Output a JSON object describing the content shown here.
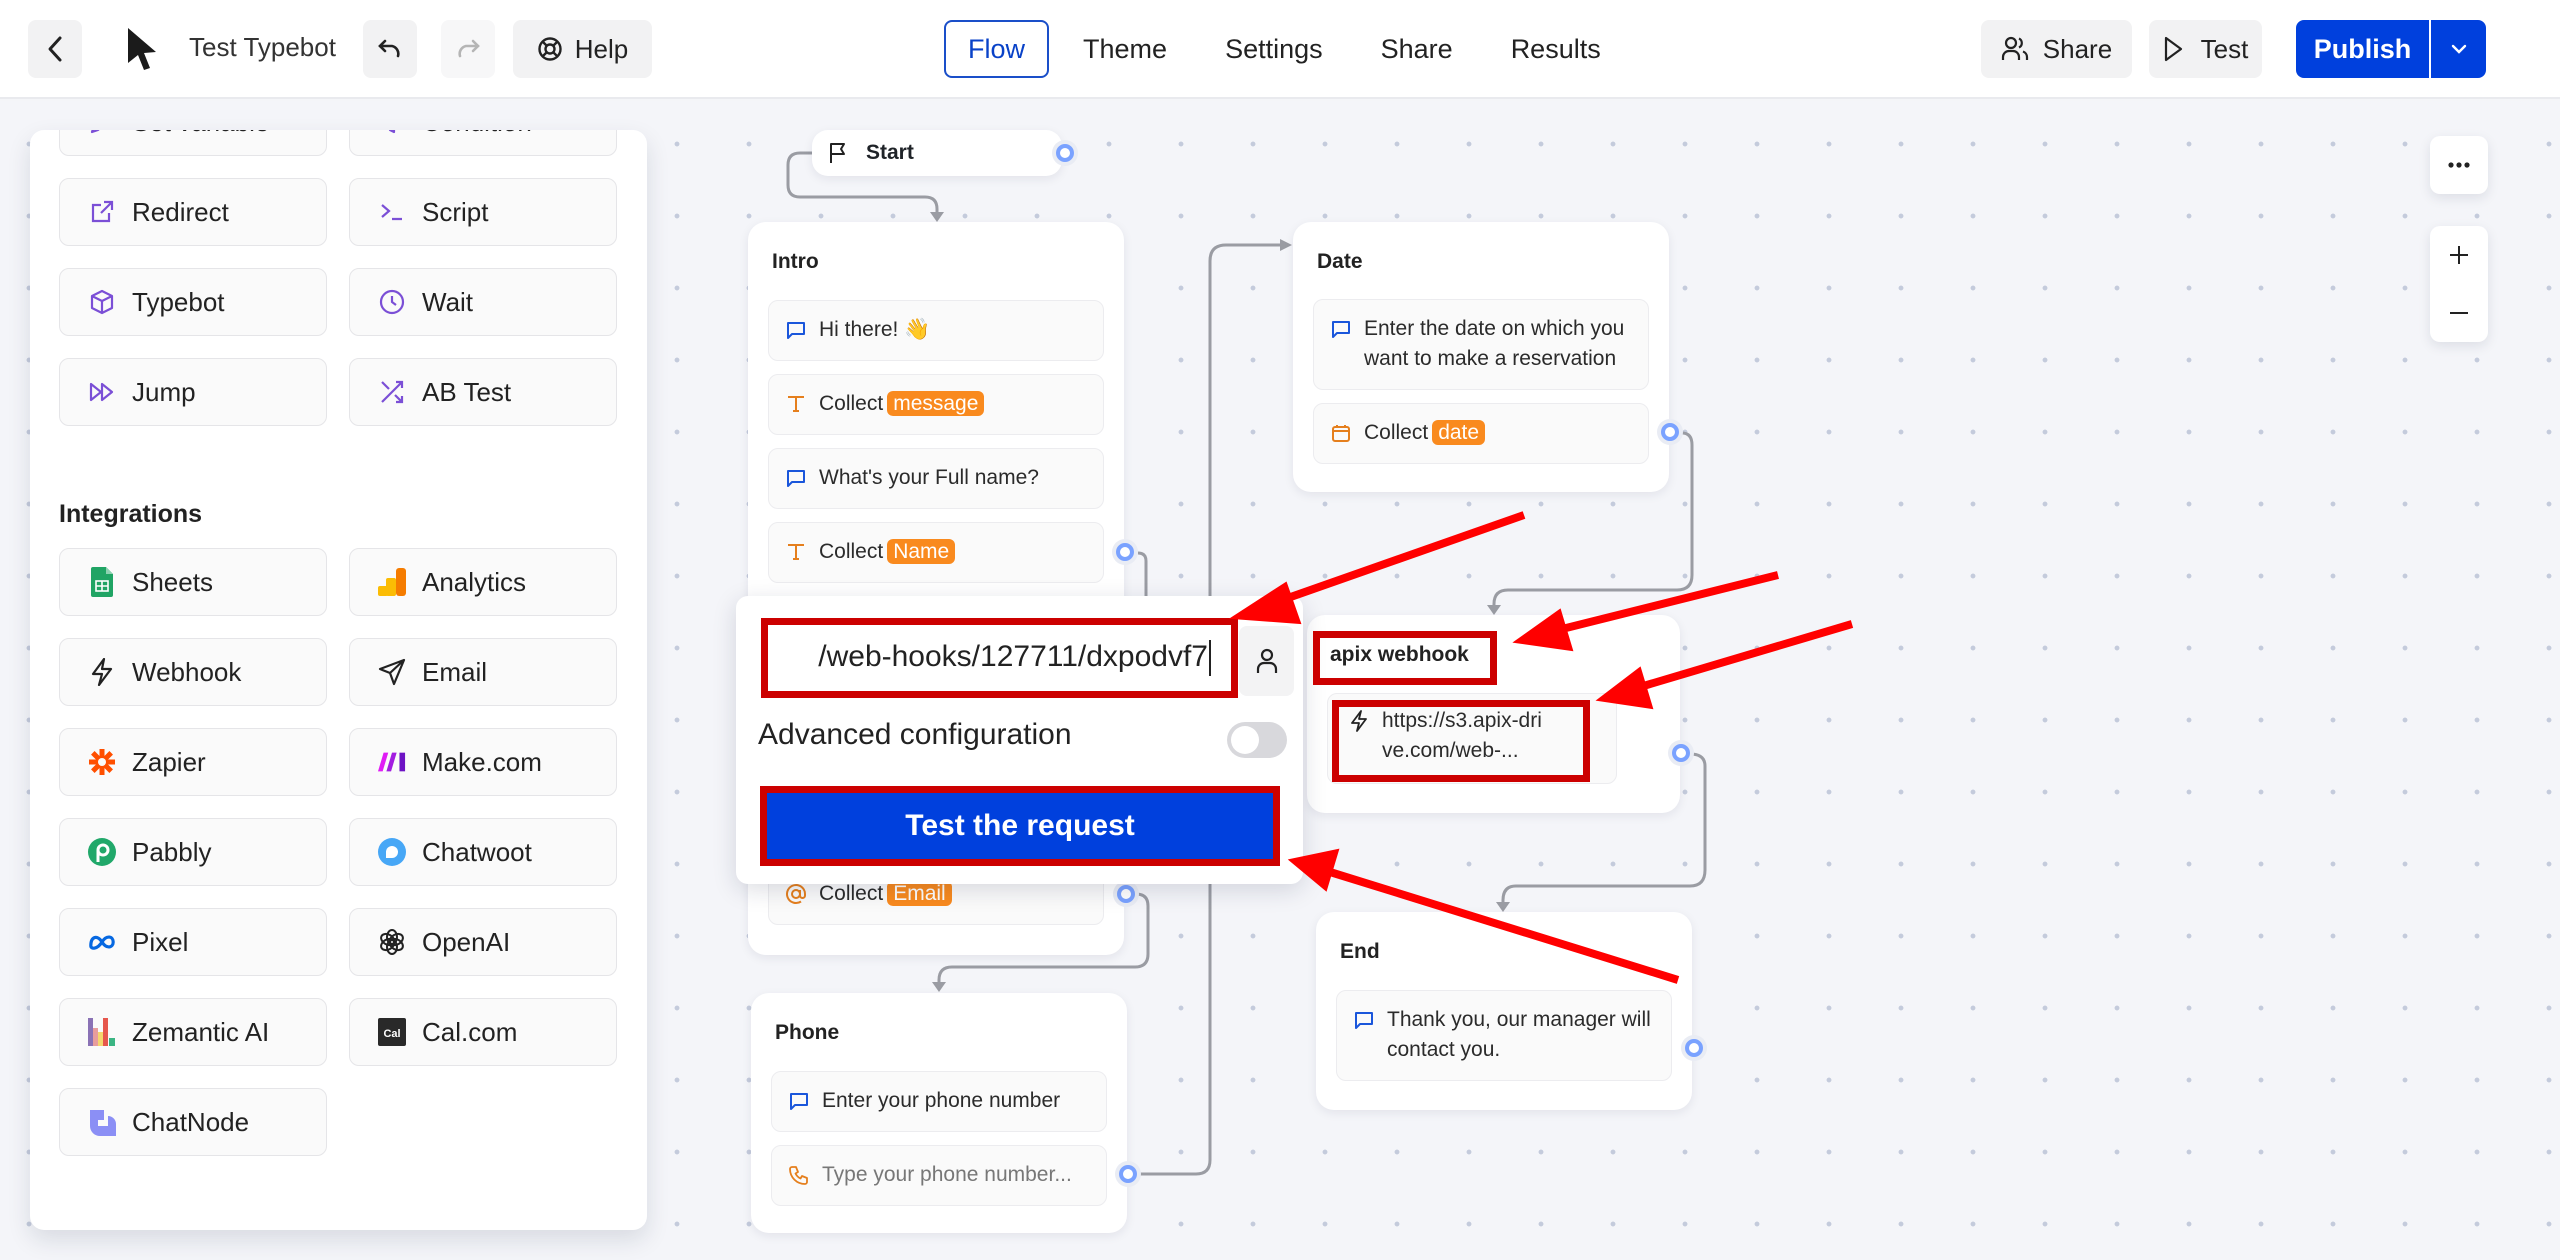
{
  "header": {
    "back_icon": "chevron-left-icon",
    "logo_icon": "cursor-arrow-logo",
    "bot_name": "Test Typebot",
    "undo_icon": "undo-icon",
    "redo_icon": "redo-icon",
    "help_label": "Help",
    "tabs": [
      {
        "label": "Flow",
        "active": true
      },
      {
        "label": "Theme",
        "active": false
      },
      {
        "label": "Settings",
        "active": false
      },
      {
        "label": "Share",
        "active": false
      },
      {
        "label": "Results",
        "active": false
      }
    ],
    "share_label": "Share",
    "test_label": "Test",
    "publish_label": "Publish",
    "accent_color": "#0040dd"
  },
  "sidebar": {
    "logic_items": [
      {
        "label": "Set variable",
        "icon": "pencil-icon"
      },
      {
        "label": "Condition",
        "icon": "filter-icon"
      },
      {
        "label": "Redirect",
        "icon": "external-link-icon"
      },
      {
        "label": "Script",
        "icon": "terminal-icon"
      },
      {
        "label": "Typebot",
        "icon": "cube-icon"
      },
      {
        "label": "Wait",
        "icon": "clock-icon"
      },
      {
        "label": "Jump",
        "icon": "fast-forward-icon"
      },
      {
        "label": "AB Test",
        "icon": "shuffle-icon"
      }
    ],
    "integrations_heading": "Integrations",
    "integration_items": [
      {
        "label": "Sheets",
        "icon": "google-sheets-icon"
      },
      {
        "label": "Analytics",
        "icon": "google-analytics-icon"
      },
      {
        "label": "Webhook",
        "icon": "lightning-icon"
      },
      {
        "label": "Email",
        "icon": "send-icon"
      },
      {
        "label": "Zapier",
        "icon": "zapier-icon"
      },
      {
        "label": "Make.com",
        "icon": "make-icon"
      },
      {
        "label": "Pabbly",
        "icon": "pabbly-icon"
      },
      {
        "label": "Chatwoot",
        "icon": "chatwoot-icon"
      },
      {
        "label": "Pixel",
        "icon": "meta-icon"
      },
      {
        "label": "OpenAI",
        "icon": "openai-icon"
      },
      {
        "label": "Zemantic AI",
        "icon": "zemantic-icon"
      },
      {
        "label": "Cal.com",
        "icon": "calcom-icon"
      },
      {
        "label": "ChatNode",
        "icon": "chatnode-icon"
      }
    ]
  },
  "flow": {
    "start": {
      "label": "Start"
    },
    "intro": {
      "title": "Intro",
      "blocks": [
        {
          "type": "text",
          "text": "Hi there! 👋"
        },
        {
          "type": "input",
          "prefix": "Collect",
          "variable": "message"
        },
        {
          "type": "text",
          "text": "What's your Full name?"
        },
        {
          "type": "input",
          "prefix": "Collect",
          "variable": "Name"
        },
        {
          "type": "input",
          "prefix": "Collect",
          "variable": "Email"
        }
      ]
    },
    "date": {
      "title": "Date",
      "blocks": [
        {
          "type": "text",
          "text": "Enter the date on which you want to make a reservation"
        },
        {
          "type": "input",
          "prefix": "Collect",
          "variable": "date"
        }
      ]
    },
    "webhook": {
      "title": "apix webhook",
      "url_preview": "https://s3.apix-drive.com/web-..."
    },
    "end": {
      "title": "End",
      "blocks": [
        {
          "type": "text",
          "text": "Thank you, our manager will contact you."
        }
      ]
    },
    "phone": {
      "title": "Phone",
      "blocks": [
        {
          "type": "text",
          "text": "Enter your phone number"
        },
        {
          "type": "input",
          "placeholder": "Type your phone number..."
        }
      ]
    }
  },
  "popover": {
    "url_value": "/web-hooks/127711/dxpodvf7",
    "advanced_label": "Advanced configuration",
    "advanced_enabled": false,
    "test_button_label": "Test the request"
  },
  "canvas_controls": {
    "more_icon": "more-horizontal-icon",
    "zoom_in_icon": "plus-icon",
    "zoom_out_icon": "minus-icon"
  },
  "annotations": {
    "highlight_color": "#cc0000",
    "arrow_color": "#ff0000"
  }
}
